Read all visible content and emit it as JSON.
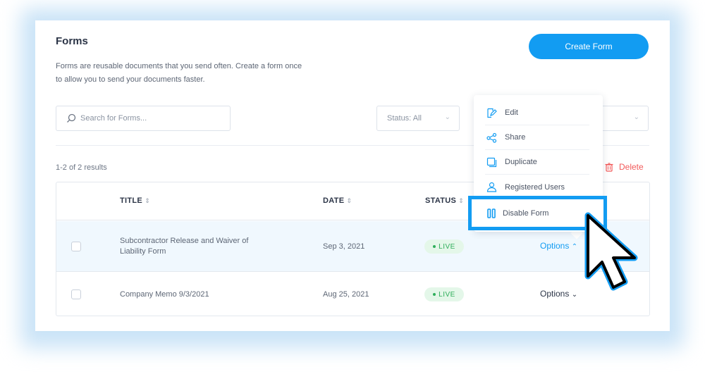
{
  "header": {
    "title": "Forms",
    "description_line1": "Forms are reusable documents that you send often. Create a form once",
    "description_line2": "to allow you to send your documents faster.",
    "create_button": "Create Form"
  },
  "filters": {
    "search_placeholder": "Search for Forms...",
    "status_value": "Status: All"
  },
  "results": {
    "count_text": "1-2 of 2 results",
    "delete_label": "Delete"
  },
  "table": {
    "columns": [
      "TITLE",
      "DATE",
      "STATUS"
    ],
    "rows": [
      {
        "title_line1": "Subcontractor Release and Waiver of",
        "title_line2": "Liability Form",
        "date": "Sep 3, 2021",
        "status": "LIVE",
        "options": "Options"
      },
      {
        "title_line1": "Company Memo 9/3/2021",
        "title_line2": "",
        "date": "Aug 25, 2021",
        "status": "LIVE",
        "options": "Options"
      }
    ]
  },
  "menu": {
    "items": [
      {
        "label": "Edit",
        "icon": "edit-icon"
      },
      {
        "label": "Share",
        "icon": "share-icon"
      },
      {
        "label": "Duplicate",
        "icon": "duplicate-icon"
      },
      {
        "label": "Registered Users",
        "icon": "user-icon"
      }
    ],
    "highlighted": {
      "label": "Disable Form",
      "icon": "pause-icon"
    }
  },
  "colors": {
    "accent": "#129cf2",
    "live_green": "#2fae5b",
    "delete_red": "#f25a5a"
  }
}
